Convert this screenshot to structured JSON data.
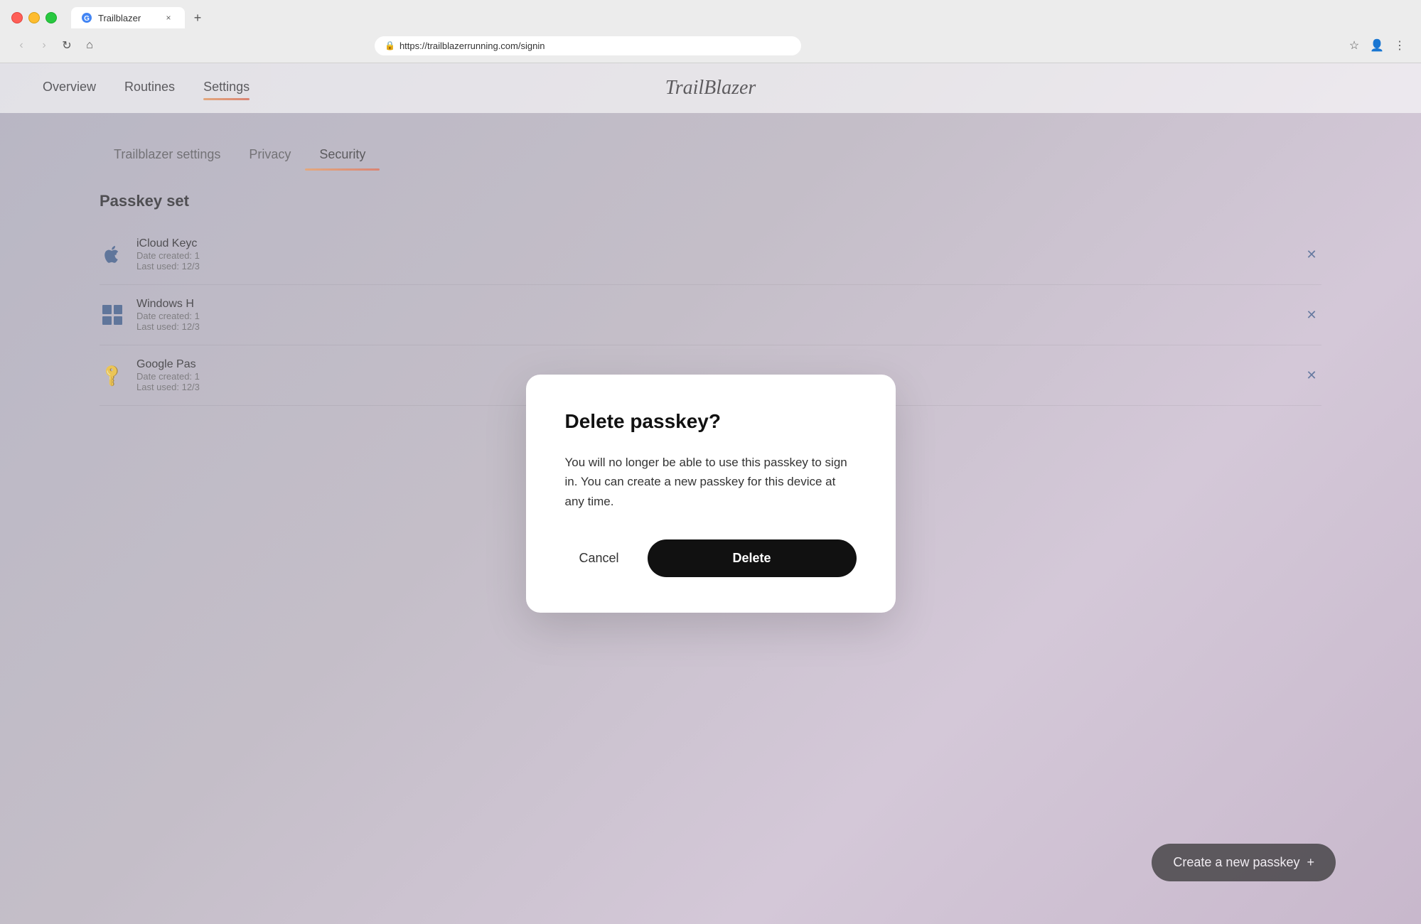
{
  "browser": {
    "tab_title": "Trailblazer",
    "tab_close": "×",
    "tab_new": "+",
    "url": "https://trailblazerrunning.com/signin",
    "back_btn": "‹",
    "forward_btn": "›",
    "refresh_btn": "↻",
    "home_btn": "⌂"
  },
  "nav": {
    "links": [
      {
        "label": "Overview",
        "active": false
      },
      {
        "label": "Routines",
        "active": false
      },
      {
        "label": "Settings",
        "active": true
      }
    ],
    "logo": "TrailBlazer"
  },
  "settings": {
    "tabs": [
      {
        "label": "Trailblazer settings",
        "active": false
      },
      {
        "label": "Privacy",
        "active": false
      },
      {
        "label": "Security",
        "active": true
      }
    ]
  },
  "passkey_section": {
    "title": "Passkey set",
    "items": [
      {
        "name": "iCloud Keyc",
        "date_created": "Date created: 1",
        "last_used": "Last used: 12/3",
        "icon_type": "apple"
      },
      {
        "name": "Windows H",
        "date_created": "Date created: 1",
        "last_used": "Last used: 12/3",
        "icon_type": "windows"
      },
      {
        "name": "Google Pas",
        "date_created": "Date created: 1",
        "last_used": "Last used: 12/3",
        "icon_type": "key"
      }
    ],
    "create_button_label": "Create a new passkey",
    "create_button_icon": "+"
  },
  "modal": {
    "title": "Delete passkey?",
    "body": "You will no longer be able to use this passkey to sign in. You can create a new passkey for this device at any time.",
    "cancel_label": "Cancel",
    "delete_label": "Delete"
  }
}
